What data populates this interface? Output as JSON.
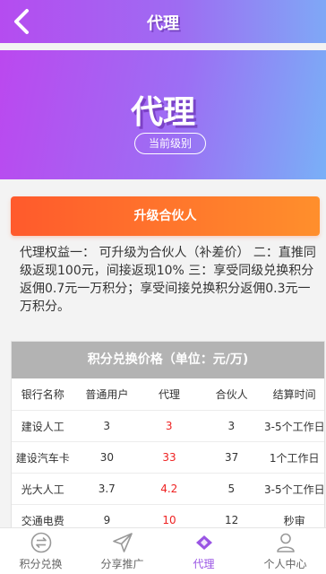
{
  "header": {
    "title": "代理"
  },
  "hero": {
    "title": "代理",
    "badge": "当前级别"
  },
  "upgrade": {
    "label": "升级合伙人"
  },
  "benefits_text": "代理权益一： 可升级为合伙人（补差价） 二：直推同级返现100元，间接返现10% 三：享受同级兑换积分返佣0.7元一万积分；享受间接兑换积分返佣0.3元一万积分。",
  "table": {
    "title": "积分兑换价格（单位：元/万)",
    "columns": [
      "银行名称",
      "普通用户",
      "代理",
      "合伙人",
      "结算时间"
    ],
    "rows": [
      [
        "建设人工",
        "3",
        "3",
        "3",
        "3-5个工作日"
      ],
      [
        "建设汽车卡",
        "30",
        "33",
        "37",
        "1个工作日"
      ],
      [
        "光大人工",
        "3.7",
        "4.2",
        "5",
        "3-5个工作日"
      ],
      [
        "交通电费",
        "9",
        "10",
        "12",
        "秒审"
      ]
    ]
  },
  "tabs": [
    {
      "label": "积分兑换",
      "icon": "exchange-icon"
    },
    {
      "label": "分享推广",
      "icon": "paper-plane-icon"
    },
    {
      "label": "代理",
      "icon": "diamond-icon",
      "active": true
    },
    {
      "label": "个人中心",
      "icon": "user-icon"
    }
  ],
  "colors": {
    "accent": "#9a55e4",
    "button": "#ff6a2c",
    "highlight": "#e22222"
  }
}
